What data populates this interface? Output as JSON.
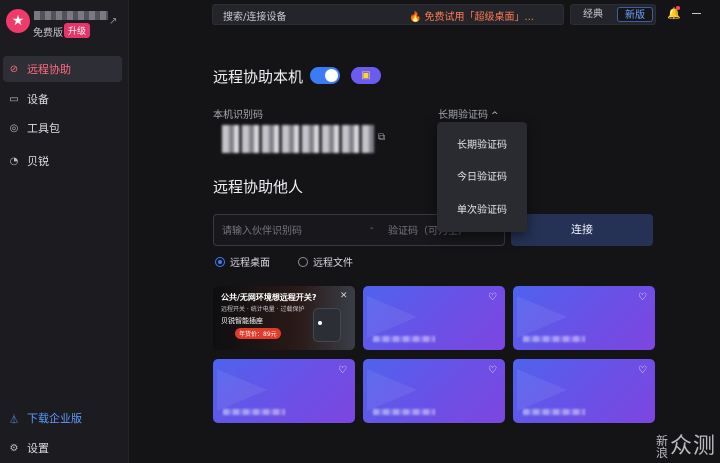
{
  "sidebar": {
    "account": {
      "plan": "免费版",
      "upgrade": "升级",
      "avatar_icon": "star-avatar-icon"
    },
    "items": [
      {
        "label": "远程协助",
        "icon": "remote-assist-icon",
        "active": true
      },
      {
        "label": "设备",
        "icon": "monitor-icon",
        "active": false
      },
      {
        "label": "工具包",
        "icon": "compass-icon",
        "active": false
      },
      {
        "label": "贝锐",
        "icon": "brand-icon",
        "active": false
      }
    ],
    "bottom": [
      {
        "label": "下载企业版",
        "icon": "enterprise-icon"
      },
      {
        "label": "设置",
        "icon": "settings-icon"
      }
    ]
  },
  "topbar": {
    "search_label": "搜索/连接设备",
    "promo": "免费试用「超级桌面」...",
    "view_classic": "经典",
    "view_new": "新版"
  },
  "assist_self": {
    "title": "远程协助本机",
    "toggle_on": true,
    "id_label": "本机识别码",
    "code_label": "长期验证码",
    "code_options": [
      "长期验证码",
      "今日验证码",
      "单次验证码"
    ]
  },
  "assist_other": {
    "title": "远程协助他人",
    "partner_placeholder": "请输入伙伴识别码",
    "separator": "-",
    "verify_placeholder": "验证码（可为空）",
    "connect_label": "连接",
    "modes": [
      {
        "label": "远程桌面",
        "selected": true
      },
      {
        "label": "远程文件",
        "selected": false
      }
    ]
  },
  "ad": {
    "title": "公共/无网环境想远程开关?",
    "subtitle": "远程开关 · 统计电量 · 过载保护",
    "slogan": "贝锐智能插座",
    "price": "年货价：89元"
  },
  "watermark": {
    "main": "众测",
    "side": "新浪"
  },
  "colors": {
    "accent": "#3c7af6",
    "active_nav": "#ff6b7d",
    "promo": "#ff7a55",
    "brand_pink": "#e6356b"
  }
}
